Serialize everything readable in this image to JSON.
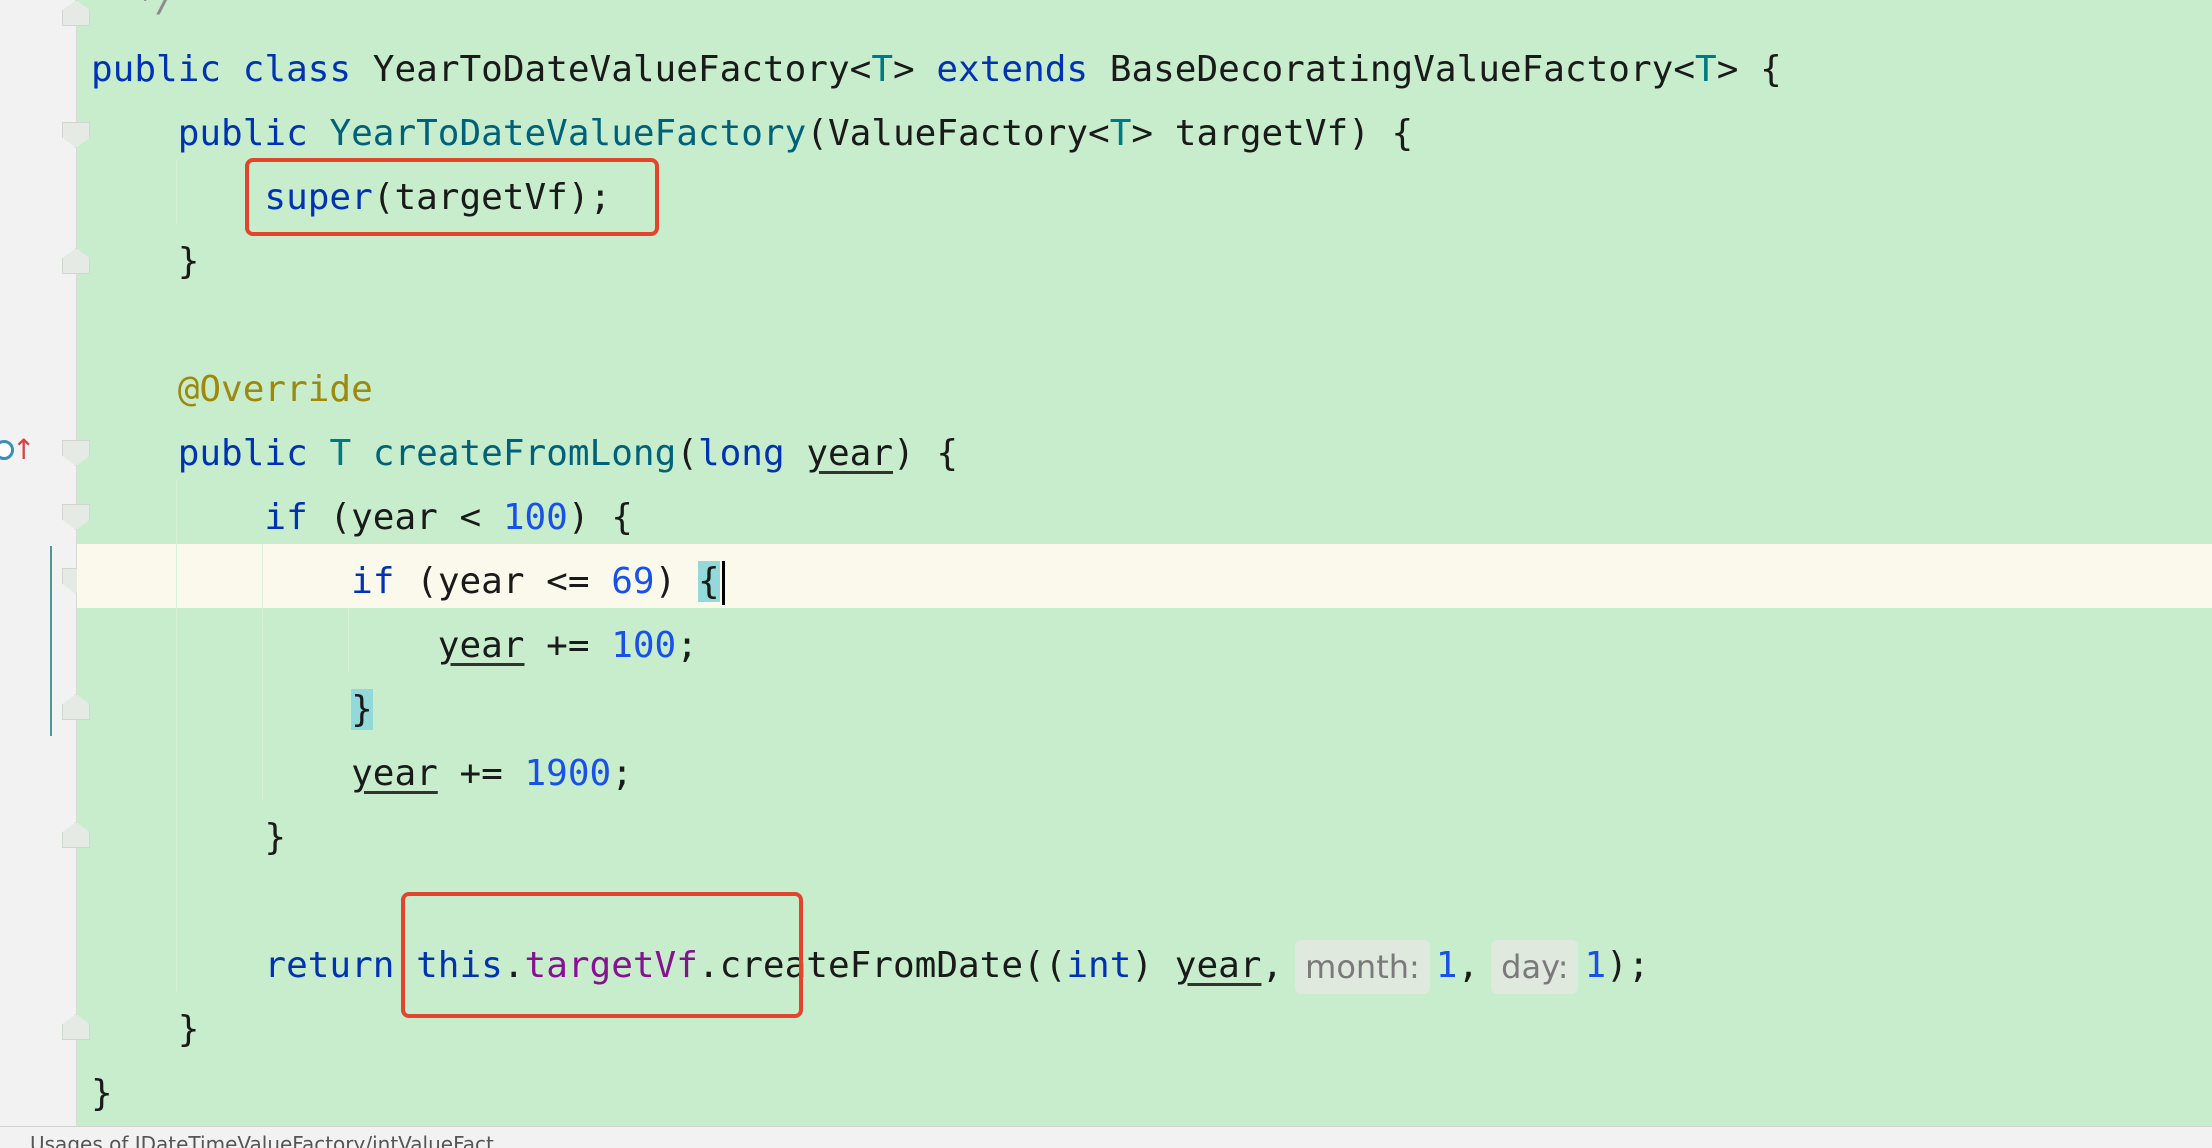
{
  "editor": {
    "comment_end": "*/",
    "class_decl": {
      "kw_public": "public",
      "kw_class": "class",
      "name": "YearToDateValueFactory",
      "type_param_open": "<",
      "type_param": "T",
      "type_param_close": ">",
      "kw_extends": "extends",
      "base": "BaseDecoratingValueFactory",
      "base_tp_open": "<",
      "base_tp": "T",
      "base_tp_close": ">",
      "brace": "{"
    },
    "ctor_decl": {
      "kw_public": "public",
      "name": "YearToDateValueFactory",
      "open": "(",
      "param_type": "ValueFactory",
      "tp_open": "<",
      "tp": "T",
      "tp_close": ">",
      "param": "targetVf",
      "close": ") {"
    },
    "super_call": {
      "kw": "super",
      "rest": "(targetVf);"
    },
    "ctor_close": "}",
    "annotation": "@Override",
    "method_decl": {
      "kw_public": "public",
      "ret": "T",
      "name": "createFromLong",
      "open": "(",
      "kw_long": "long",
      "param": "year",
      "close": ") {"
    },
    "if1": {
      "kw": "if",
      "pre": "(year < ",
      "num": "100",
      "post": ") {"
    },
    "if2": {
      "kw": "if",
      "pre": "(year <= ",
      "num": "69",
      "post": ") ",
      "brace": "{"
    },
    "add100": {
      "var": "year",
      "op": " += ",
      "num": "100",
      "end": ";"
    },
    "if2_close": "}",
    "add1900": {
      "var": "year",
      "op": " += ",
      "num": "1900",
      "end": ";"
    },
    "if1_close": "}",
    "return_stmt": {
      "kw": "return",
      "this": "this",
      "dot": ".",
      "field": "targetVf",
      "call": ".createFromDate((",
      "kw_int": "int",
      "cast_close": ") ",
      "var": "year",
      "comma": ",",
      "hint_month": "month:",
      "month_val": "1",
      "comma2": ",",
      "hint_day": "day:",
      "day_val": "1",
      "end": ");"
    },
    "method_close": "}",
    "class_close": "}"
  },
  "status_bar": {
    "text": "Usages of IDateTimeValueFactory/intValueFact..."
  },
  "colors": {
    "background": "#c7edcc",
    "caret_line": "#fbf9ec",
    "keyword": "#0033b3",
    "number": "#1750eb",
    "annotation": "#9e880d",
    "field": "#871094",
    "highlight_box": "#e2452b"
  },
  "icons": [
    "override-method-icon",
    "fold-icon"
  ]
}
